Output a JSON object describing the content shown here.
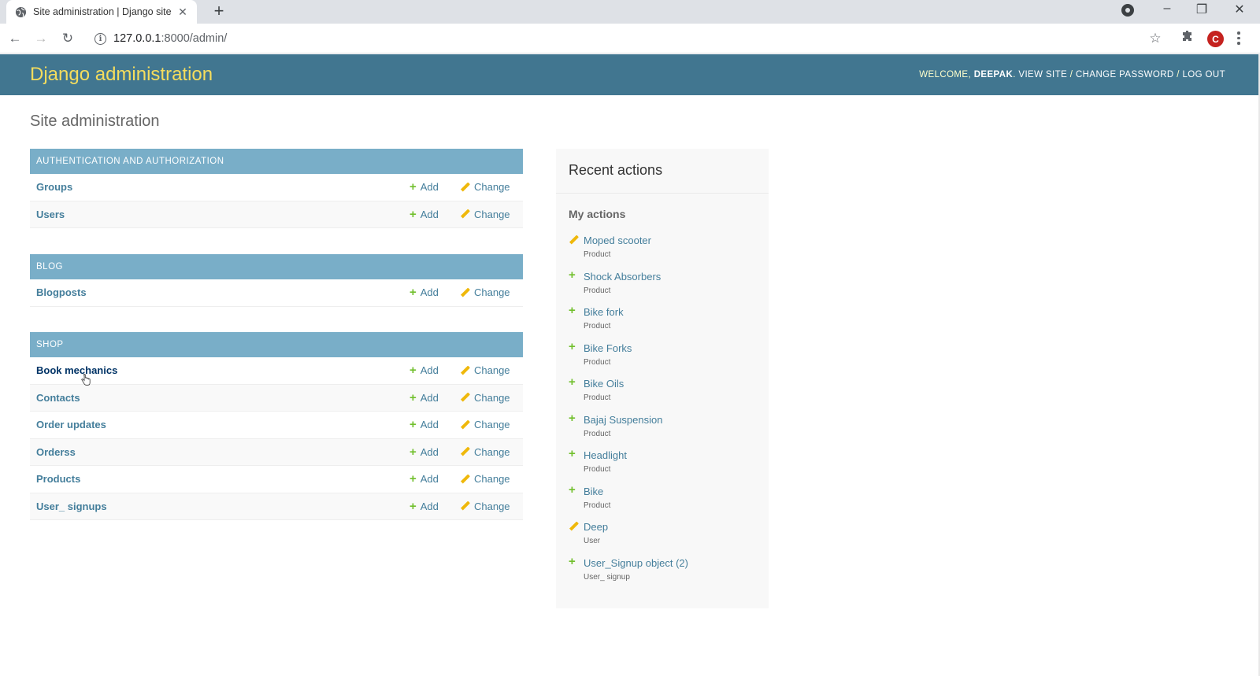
{
  "browser": {
    "tab_title": "Site administration | Django site",
    "url_host": "127.0.0.1",
    "url_rest": ":8000/admin/",
    "profile_initial": "C"
  },
  "header": {
    "branding": "Django administration",
    "welcome": "WELCOME,",
    "username": "DEEPAK",
    "view_site": "VIEW SITE",
    "change_password": "CHANGE PASSWORD",
    "log_out": "LOG OUT",
    "separator": "/"
  },
  "page_title": "Site administration",
  "labels": {
    "add": "Add",
    "change": "Change"
  },
  "modules": [
    {
      "caption": "AUTHENTICATION AND AUTHORIZATION",
      "models": [
        "Groups",
        "Users"
      ]
    },
    {
      "caption": "BLOG",
      "models": [
        "Blogposts"
      ]
    },
    {
      "caption": "SHOP",
      "models": [
        "Book mechanics",
        "Contacts",
        "Order updates",
        "Orderss",
        "Products",
        "User_ signups"
      ]
    }
  ],
  "recent_actions": {
    "title": "Recent actions",
    "subtitle": "My actions",
    "items": [
      {
        "action": "change",
        "name": "Moped scooter",
        "type": "Product"
      },
      {
        "action": "add",
        "name": "Shock Absorbers",
        "type": "Product"
      },
      {
        "action": "add",
        "name": "Bike fork",
        "type": "Product"
      },
      {
        "action": "add",
        "name": "Bike Forks",
        "type": "Product"
      },
      {
        "action": "add",
        "name": "Bike Oils",
        "type": "Product"
      },
      {
        "action": "add",
        "name": "Bajaj Suspension",
        "type": "Product"
      },
      {
        "action": "add",
        "name": "Headlight",
        "type": "Product"
      },
      {
        "action": "add",
        "name": "Bike",
        "type": "Product"
      },
      {
        "action": "change",
        "name": "Deep",
        "type": "User"
      },
      {
        "action": "add",
        "name": "User_Signup object (2)",
        "type": "User_ signup"
      }
    ]
  },
  "colors": {
    "header_bg": "#417690",
    "branding": "#f5dd5d",
    "caption_bg": "#79aec8",
    "link": "#447e9b",
    "add_green": "#70bf2b",
    "change_yellow": "#efb80b"
  }
}
